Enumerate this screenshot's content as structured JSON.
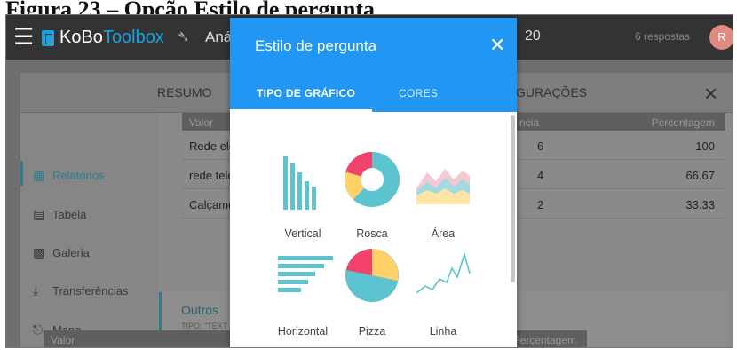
{
  "caption": "Figura 23 – Opção Estilo de pergunta",
  "topbar": {
    "logo_a": "KoBo",
    "logo_b": "Toolbox",
    "project": "Aná",
    "year_fragment": "20",
    "responses": "6 respostas",
    "avatar": "R"
  },
  "tabs": {
    "resumo": "RESUMO",
    "config": "GURAÇÕES"
  },
  "sidebar": {
    "items": [
      {
        "label": "Relatórios"
      },
      {
        "label": "Tabela"
      },
      {
        "label": "Galeria"
      },
      {
        "label": "Transferências"
      },
      {
        "label": "Mapa"
      }
    ]
  },
  "table": {
    "headers": [
      "Valor",
      "ncia",
      "Percentagem"
    ],
    "rows": [
      [
        "Rede elé",
        "6",
        "100"
      ],
      [
        "rede tele",
        "4",
        "66.67"
      ],
      [
        "Calçame",
        "2",
        "33.33"
      ]
    ]
  },
  "outros": {
    "title": "Outros",
    "subtitle": "TIPO: \"TEXT"
  },
  "table2": {
    "headers": [
      "Valor",
      "Percentagem"
    ]
  },
  "modal": {
    "title": "Estilo de pergunta",
    "tabs": [
      "TIPO DE GRÁFICO",
      "CORES"
    ],
    "accent": "#2196f3",
    "options": [
      {
        "label": "Vertical",
        "icon": "vertical-bar-chart-icon"
      },
      {
        "label": "Rosca",
        "icon": "donut-chart-icon"
      },
      {
        "label": "Área",
        "icon": "area-chart-icon"
      },
      {
        "label": "Horizontal",
        "icon": "horizontal-bar-chart-icon"
      },
      {
        "label": "Pizza",
        "icon": "pie-chart-icon"
      },
      {
        "label": "Linha",
        "icon": "line-chart-icon"
      }
    ]
  }
}
